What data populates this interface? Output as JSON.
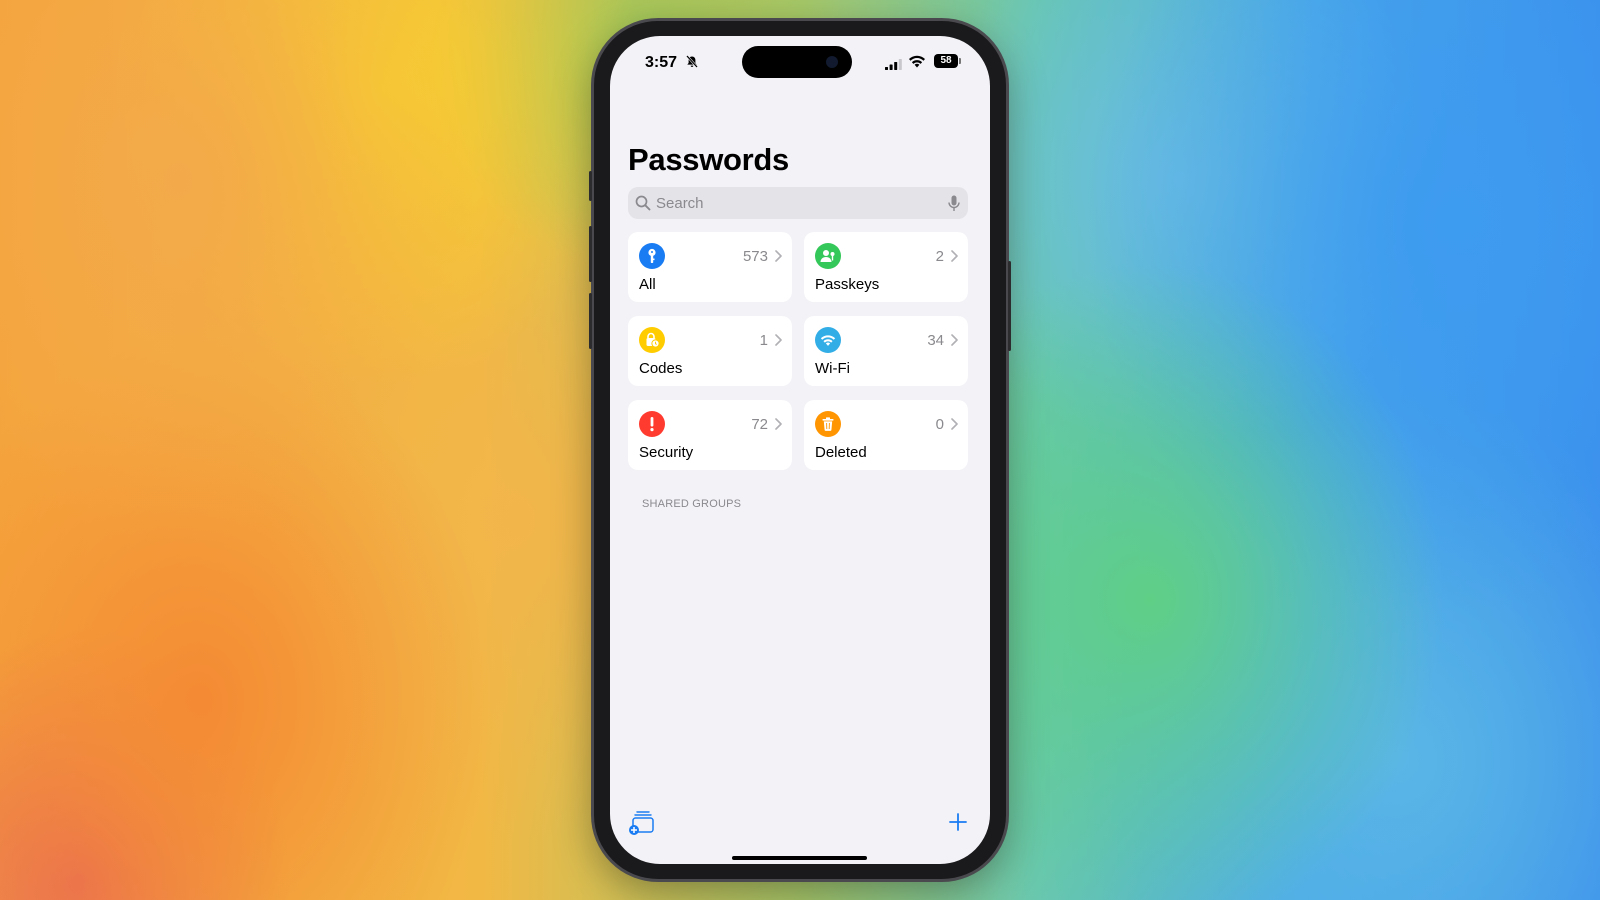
{
  "status_bar": {
    "time": "3:57",
    "battery": "58"
  },
  "page": {
    "title": "Passwords"
  },
  "search": {
    "placeholder": "Search"
  },
  "categories": [
    {
      "label": "All",
      "count": "573",
      "icon": "key-icon",
      "color": "#1a7cf2"
    },
    {
      "label": "Passkeys",
      "count": "2",
      "icon": "person-key-icon",
      "color": "#34c759"
    },
    {
      "label": "Codes",
      "count": "1",
      "icon": "lock-clock-icon",
      "color": "#ffcc00"
    },
    {
      "label": "Wi-Fi",
      "count": "34",
      "icon": "wifi-icon",
      "color": "#32ade6"
    },
    {
      "label": "Security",
      "count": "72",
      "icon": "exclamation-icon",
      "color": "#ff3b30"
    },
    {
      "label": "Deleted",
      "count": "0",
      "icon": "trash-icon",
      "color": "#ff9500"
    }
  ],
  "sections": {
    "shared_groups": "SHARED GROUPS"
  },
  "toolbar": {
    "new_group_icon": "new-group-icon",
    "add_icon": "plus-icon"
  }
}
